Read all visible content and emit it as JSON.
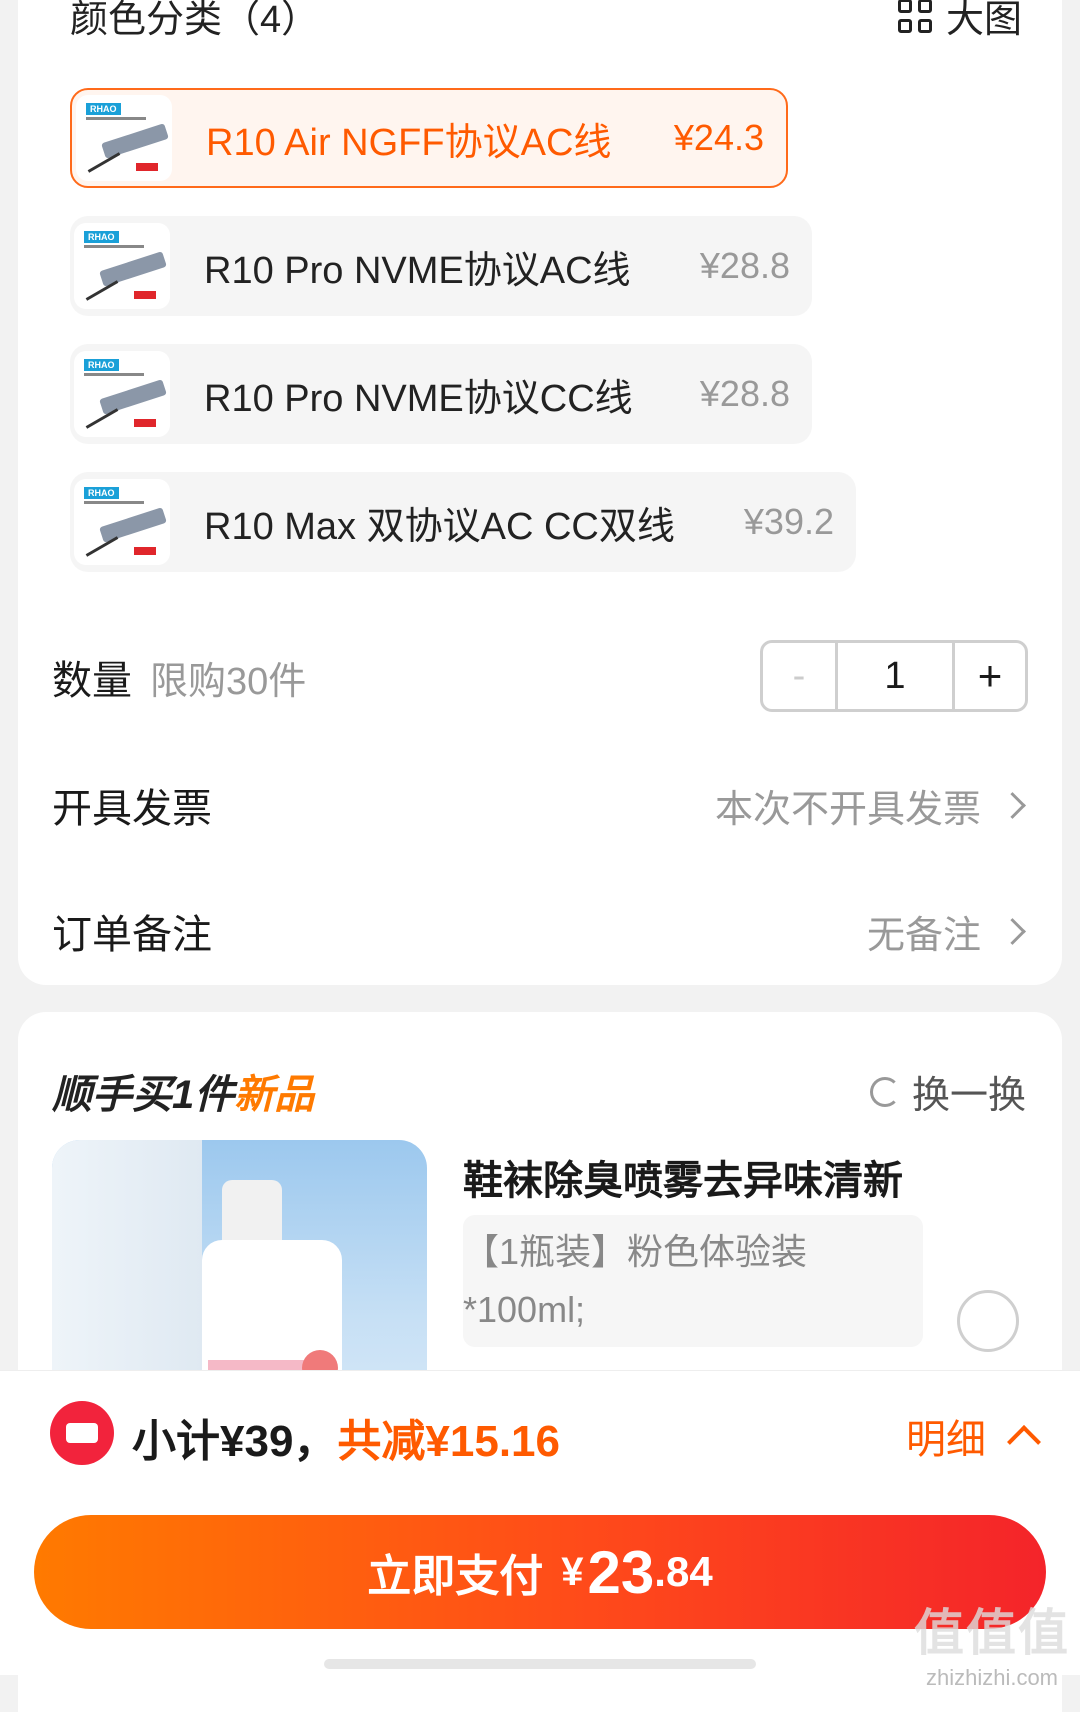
{
  "colors_section": {
    "title": "颜色分类（4）",
    "big_image_label": "大图",
    "options": [
      {
        "name": "R10 Air NGFF协议AC线",
        "price": "¥24.3",
        "selected": true,
        "thumb_brand": "RHAO"
      },
      {
        "name": "R10 Pro NVME协议AC线",
        "price": "¥28.8",
        "selected": false,
        "thumb_brand": "RHAO"
      },
      {
        "name": "R10 Pro NVME协议CC线",
        "price": "¥28.8",
        "selected": false,
        "thumb_brand": "RHAO"
      },
      {
        "name": "R10 Max 双协议AC CC双线",
        "price": "¥39.2",
        "selected": false,
        "thumb_brand": "RHAO"
      }
    ]
  },
  "quantity": {
    "label": "数量",
    "limit": "限购30件",
    "minus": "-",
    "value": "1",
    "plus": "+"
  },
  "invoice": {
    "label": "开具发票",
    "value": "本次不开具发票"
  },
  "remark": {
    "label": "订单备注",
    "value": "无备注"
  },
  "add_on": {
    "title_prefix": "顺手买1件",
    "title_highlight": "新品",
    "swap_label": "换一换",
    "product_title": "鞋袜除臭喷雾去异味清新",
    "spec_line1": "【1瓶装】粉色体验装",
    "spec_line2": "*100ml;"
  },
  "footer": {
    "subtotal": "小计¥39，",
    "discount": "共减¥15.16",
    "detail_label": "明细",
    "pay_label": "立即支付",
    "pay_currency": "¥",
    "pay_integer": "23",
    "pay_decimal": ".84",
    "watermark": "值值值",
    "watermark_url": "zhizhizhi.com"
  },
  "colors": {
    "accent": "#ff5a00",
    "brand_red": "#f2233c"
  }
}
